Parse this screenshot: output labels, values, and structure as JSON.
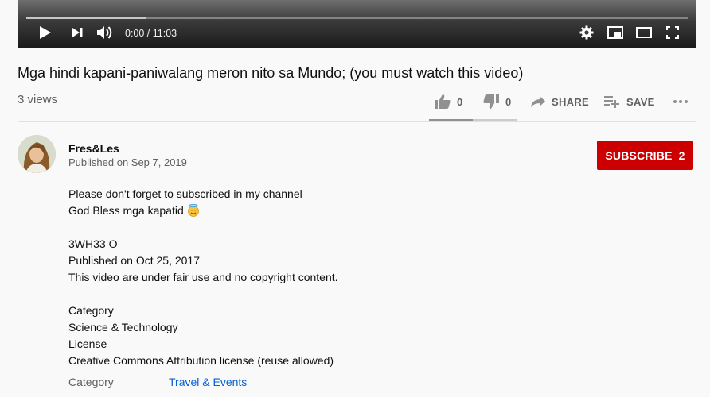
{
  "player": {
    "time": "0:00 / 11:03",
    "buffered_fraction": 0.18,
    "icons": [
      "play-icon",
      "next-icon",
      "volume-icon",
      "settings-icon",
      "miniplayer-icon",
      "theater-icon",
      "fullscreen-icon"
    ]
  },
  "video": {
    "title": "Mga hindi kapani-paniwalang meron nito sa Mundo; (you must watch this video)",
    "views": "3 views"
  },
  "actions": {
    "likes": "0",
    "dislikes": "0",
    "share_label": "SHARE",
    "save_label": "SAVE",
    "like_fraction": 0.5
  },
  "channel": {
    "name": "Fres&Les",
    "published": "Published on Sep 7, 2019",
    "subscribe_label": "SUBSCRIBE",
    "subscriber_count": "2"
  },
  "description": {
    "lines": [
      "Please don't forget to subscribed in my channel",
      "God Bless mga kapatid",
      "",
      "3WH33 O",
      "Published on Oct 25, 2017",
      "This video are under fair use and no copyright content.",
      "",
      "Category",
      "Science & Technology",
      "License",
      "Creative Commons Attribution license (reuse allowed)"
    ]
  },
  "metadata": {
    "category_label": "Category",
    "category_value": "Travel & Events"
  },
  "colors": {
    "subscribe": "#cc0000",
    "link": "#065fd4",
    "secondary_text": "#606060"
  }
}
